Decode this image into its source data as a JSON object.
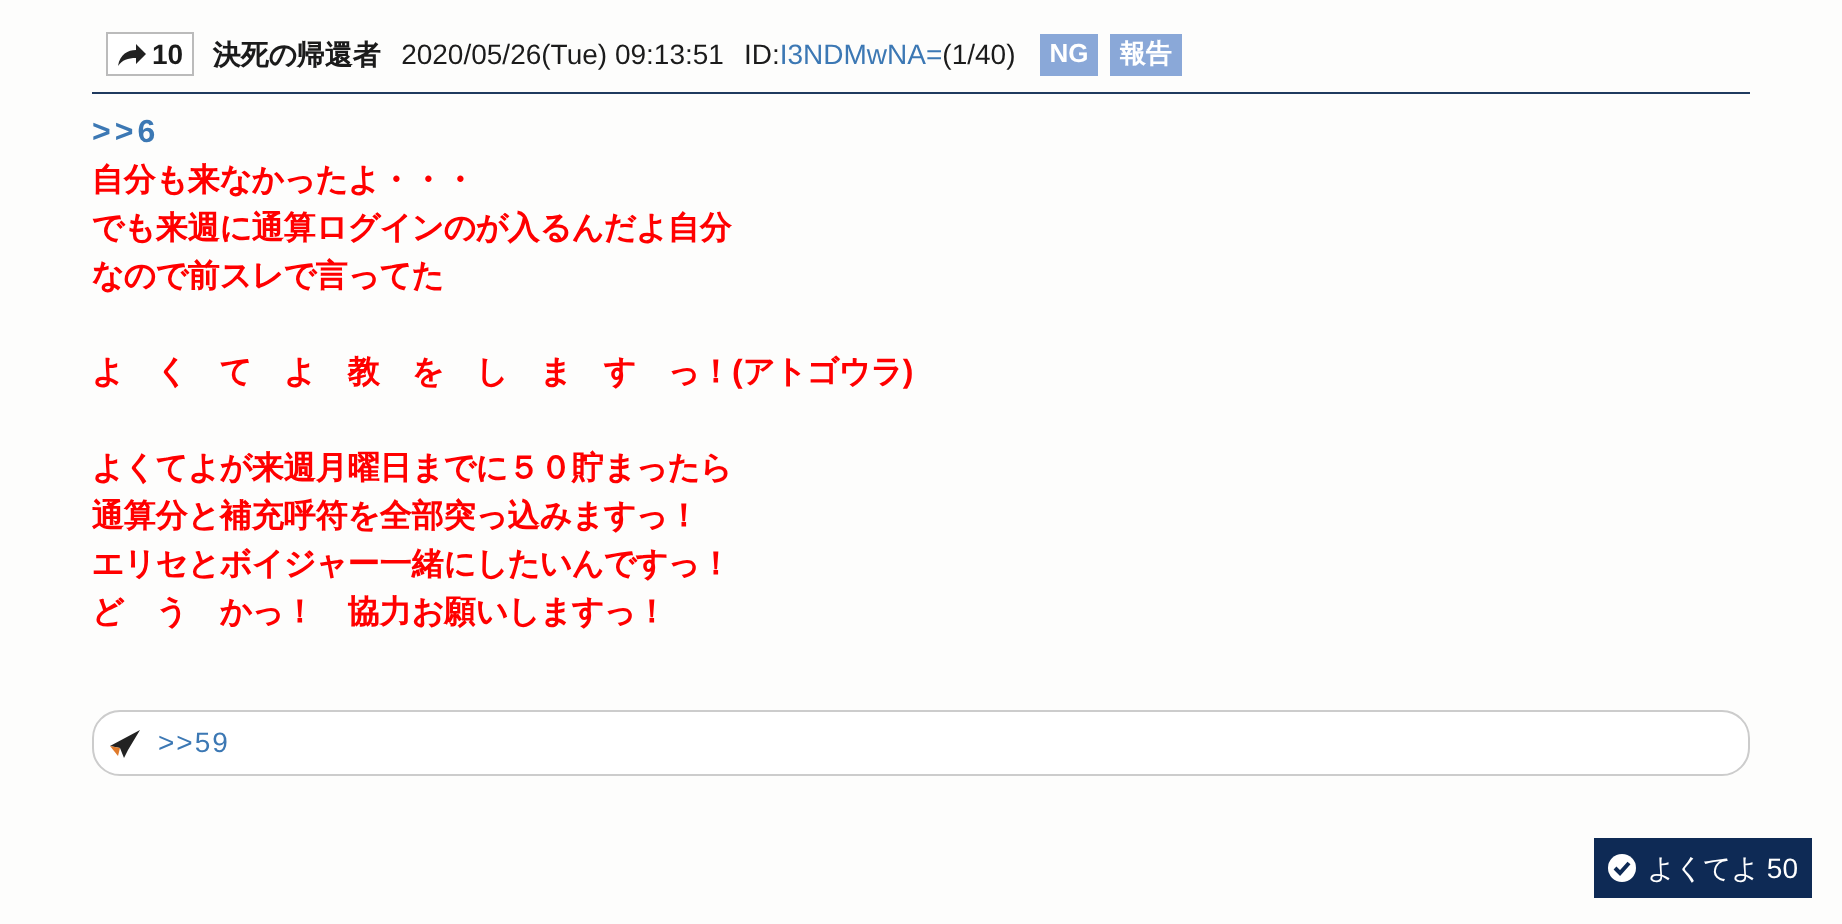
{
  "post": {
    "share_count": "10",
    "author": "決死の帰還者",
    "date": "2020/05/26(Tue) 09:13:51",
    "id_label": "ID:",
    "id": "I3NDMwNA=",
    "id_count": "(1/40)",
    "buttons": [
      "NG",
      "報告"
    ]
  },
  "body": {
    "reply_link": ">>6",
    "paragraphs": [
      [
        "自分も来なかったよ・・・",
        "でも来週に通算ログインのが入るんだよ自分",
        "なので前スレで言ってた"
      ],
      [
        "よ　く　て　よ　教　を　し　ま　す　っ！(アトゴウラ)"
      ],
      [
        "よくてよが来週月曜日までに５０貯まったら",
        "通算分と補充呼符を全部突っ込みますっ！",
        "エリセとボイジャー一緒にしたいんですっ！",
        "ど　う　かっ！　協力お願いしますっ！"
      ]
    ]
  },
  "reply_field": {
    "value": ">>59"
  },
  "like_button": {
    "label": "よくてよ",
    "count": "50"
  }
}
